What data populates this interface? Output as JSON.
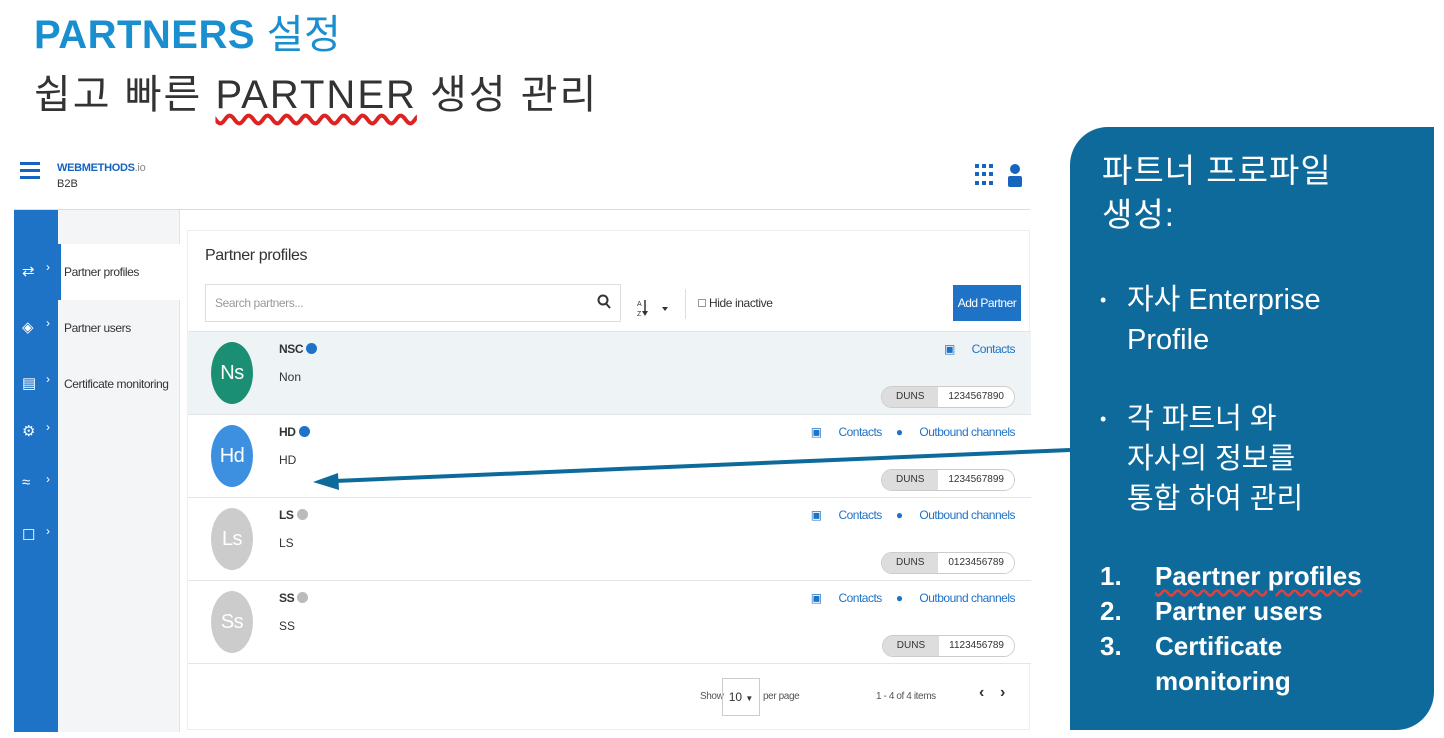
{
  "slide": {
    "title_en": "PARTNERS",
    "title_kr": "설정",
    "subtitle_pre": "쉽고 빠른 ",
    "subtitle_u": "PARTNER",
    "subtitle_post": " 생성 관리"
  },
  "app": {
    "brand": "WEBMETHODS",
    "brand_suffix": ".io",
    "brand_sub": "B2B",
    "sidenav": [
      "Partner profiles",
      "Partner users",
      "Certificate monitoring"
    ],
    "page_title": "Partner profiles",
    "search_placeholder": "Search partners...",
    "hide_inactive": "Hide inactive",
    "add_partner": "Add Partner",
    "duns_label": "DUNS",
    "contacts_label": "Contacts",
    "outbound_label": "Outbound channels",
    "partners": [
      {
        "initials": "Ns",
        "name": "NSC",
        "desc": "Non",
        "duns": "1234567890",
        "color": "#1b8f73",
        "check_color": "#1f73c7",
        "has_outbound": false,
        "selected": true
      },
      {
        "initials": "Hd",
        "name": "HD",
        "desc": "HD",
        "duns": "1234567899",
        "color": "#3d8fdf",
        "check_color": "#1f73c7",
        "has_outbound": true,
        "selected": false
      },
      {
        "initials": "Ls",
        "name": "LS",
        "desc": "LS",
        "duns": "0123456789",
        "color": "#cccccc",
        "check_color": "#bbbbbb",
        "has_outbound": true,
        "selected": false
      },
      {
        "initials": "Ss",
        "name": "SS",
        "desc": "SS",
        "duns": "1123456789",
        "color": "#cccccc",
        "check_color": "#bbbbbb",
        "has_outbound": true,
        "selected": false
      }
    ],
    "pagination": {
      "show": "Show",
      "per_page_value": "10",
      "per_page": "per page",
      "range": "1 - 4 of 4 items"
    }
  },
  "callout": {
    "heading_line1": "파트너 프로파일",
    "heading_line2": "생성:",
    "bullet1_line1": "자사 Enterprise",
    "bullet1_line2": "Profile",
    "bullet2_line1": "각 파트너 와",
    "bullet2_line2": "자사의 정보를",
    "bullet2_line3": "통합 하여 관리",
    "list": [
      {
        "n": "1.",
        "text": "Paertner profiles"
      },
      {
        "n": "2.",
        "text": "Partner users"
      },
      {
        "n": "3.",
        "text": "Certificate"
      },
      {
        "n": "",
        "text": "monitoring"
      }
    ]
  },
  "colors": {
    "accent": "#1f73c7",
    "title_blue": "#1a8fd0",
    "callout_bg": "#0e6a9b",
    "arrow": "#0e6a9b"
  }
}
